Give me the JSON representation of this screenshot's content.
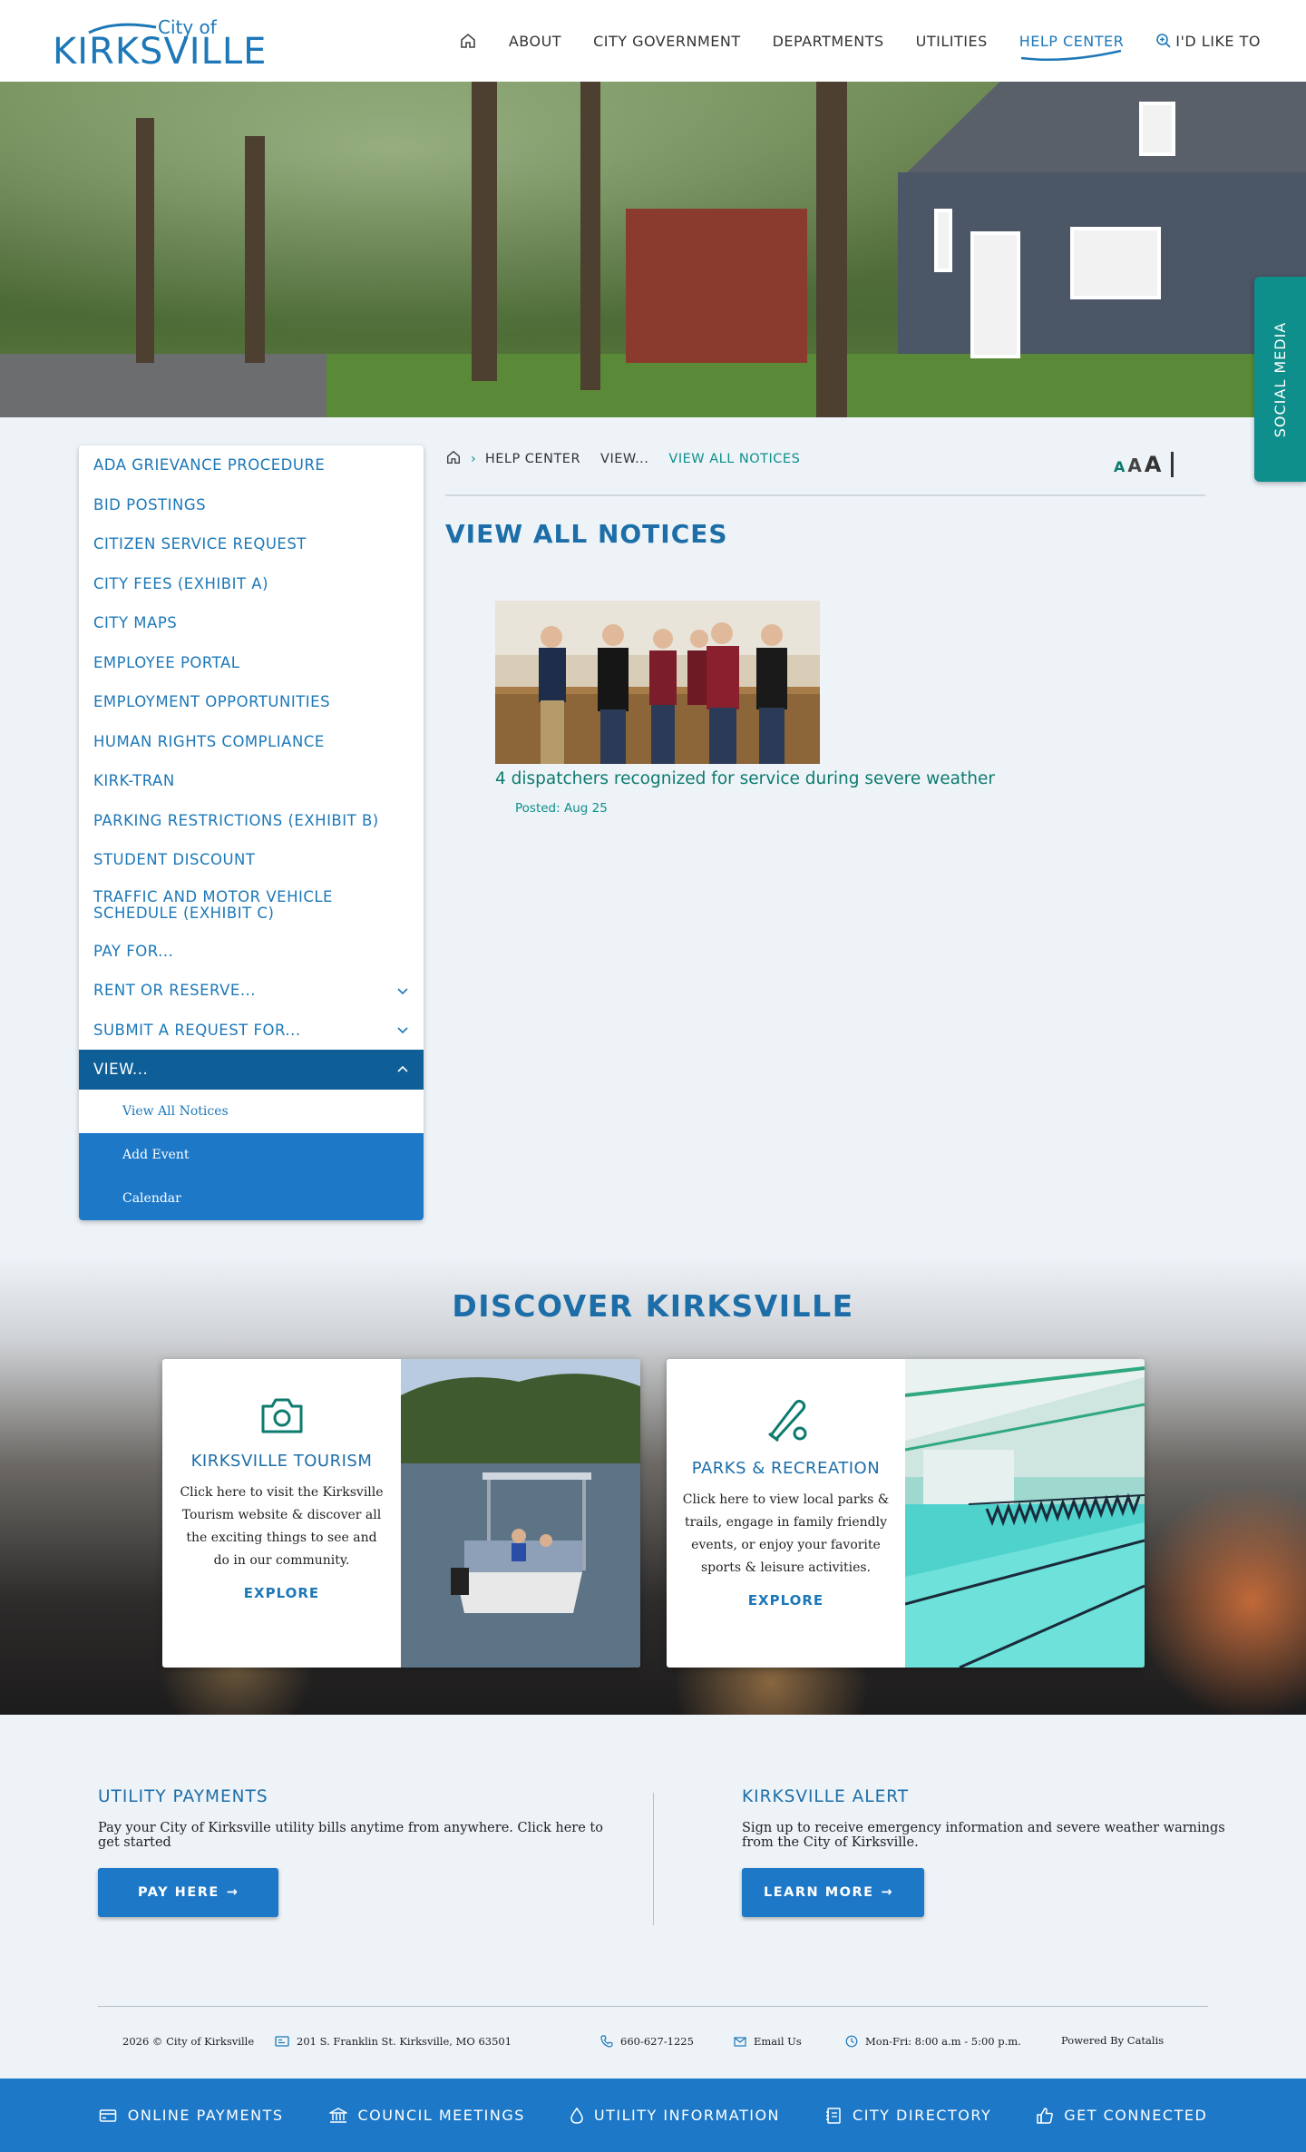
{
  "header": {
    "logo": {
      "small": "City of",
      "name": "KIRKSVILLE"
    },
    "nav": [
      {
        "label": "ABOUT"
      },
      {
        "label": "CITY GOVERNMENT"
      },
      {
        "label": "DEPARTMENTS"
      },
      {
        "label": "UTILITIES"
      },
      {
        "label": "HELP CENTER",
        "active": true
      },
      {
        "label": "I'D LIKE TO"
      }
    ]
  },
  "social_tab": {
    "label": "SOCIAL MEDIA"
  },
  "sidebar": {
    "items": [
      {
        "label": "ADA GRIEVANCE PROCEDURE"
      },
      {
        "label": "BID POSTINGS"
      },
      {
        "label": "CITIZEN SERVICE REQUEST"
      },
      {
        "label": "CITY FEES (EXHIBIT A)"
      },
      {
        "label": "CITY MAPS"
      },
      {
        "label": "EMPLOYEE PORTAL"
      },
      {
        "label": "EMPLOYMENT OPPORTUNITIES"
      },
      {
        "label": "HUMAN RIGHTS COMPLIANCE"
      },
      {
        "label": "KIRK-TRAN"
      },
      {
        "label": "PARKING RESTRICTIONS (EXHIBIT B)"
      },
      {
        "label": "STUDENT DISCOUNT"
      },
      {
        "label": "TRAFFIC AND MOTOR VEHICLE SCHEDULE (EXHIBIT C)"
      },
      {
        "label": "PAY FOR..."
      },
      {
        "label": "RENT OR RESERVE..."
      },
      {
        "label": "SUBMIT A REQUEST FOR..."
      },
      {
        "label": "VIEW..."
      }
    ],
    "sub_items": [
      {
        "label": "View All Notices"
      },
      {
        "label": "Add Event"
      },
      {
        "label": "Calendar"
      }
    ]
  },
  "breadcrumb": {
    "items": [
      "HELP CENTER",
      "VIEW...",
      "VIEW ALL NOTICES"
    ]
  },
  "text_size": {
    "small": "A",
    "medium": "A",
    "large": "A"
  },
  "main": {
    "title": "VIEW ALL NOTICES",
    "notice": {
      "title": "4 dispatchers recognized for service during severe weather",
      "date": "Posted: Aug 25"
    }
  },
  "discover": {
    "title": "DISCOVER KIRKSVILLE",
    "cards": [
      {
        "icon": "camera-icon",
        "title": "KIRKSVILLE TOURISM",
        "text": "Click here to visit the Kirksville Tourism website & discover all the exciting things to see and do in our community.",
        "link": "EXPLORE"
      },
      {
        "icon": "baseball-bat-icon",
        "title": "PARKS & RECREATION",
        "text": "Click here to view local parks & trails, engage in family friendly events, or enjoy your favorite sports & leisure activities.",
        "link": "EXPLORE"
      }
    ]
  },
  "promos": {
    "utility": {
      "title": "UTILITY PAYMENTS",
      "text": "Pay your City of Kirksville utility bills anytime from anywhere. Click here to get started",
      "button": "PAY HERE"
    },
    "alert": {
      "title": "KIRKSVILLE ALERT",
      "text": "Sign up to receive emergency information and severe weather warnings from the City of Kirksville.",
      "button": "LEARN MORE"
    }
  },
  "footer": {
    "copyright": "2026 © City of Kirksville",
    "address": "201 S. Franklin St. Kirksville, MO 63501",
    "phone": "660-627-1225",
    "email": "Email Us",
    "hours": "Mon-Fri: 8:00 a.m - 5:00 p.m.",
    "powered": "Powered By Catalis"
  },
  "bottom_bar": [
    {
      "label": "ONLINE PAYMENTS",
      "icon": "credit-card-icon"
    },
    {
      "label": "COUNCIL MEETINGS",
      "icon": "building-icon"
    },
    {
      "label": "UTILITY INFORMATION",
      "icon": "water-drop-icon"
    },
    {
      "label": "CITY DIRECTORY",
      "icon": "directory-icon"
    },
    {
      "label": "GET CONNECTED",
      "icon": "thumbs-up-icon"
    }
  ],
  "colors": {
    "primary": "#1d78c8",
    "dark_blue": "#0e5f98",
    "teal": "#0e8f8c",
    "heading_blue": "#1d6ea8"
  }
}
